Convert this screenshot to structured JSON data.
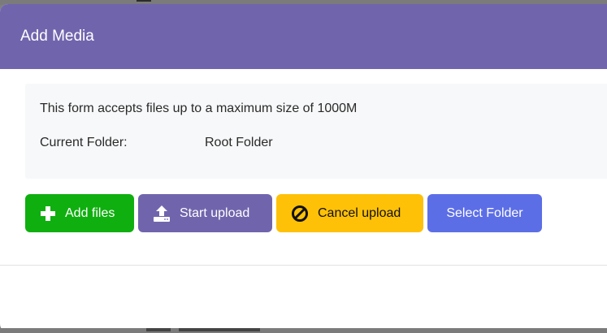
{
  "modal": {
    "title": "Add Media"
  },
  "info": {
    "limit_text": "This form accepts files up to a maximum size of 1000M",
    "current_folder_label": "Current Folder:",
    "current_folder_value": "Root Folder"
  },
  "buttons": {
    "add_files": {
      "label": "Add files",
      "icon": "plus-icon",
      "color": "#0faf0f"
    },
    "start_upload": {
      "label": "Start upload",
      "icon": "upload-icon",
      "color": "#7065ad"
    },
    "cancel_upload": {
      "label": "Cancel upload",
      "icon": "ban-icon",
      "color": "#ffc107"
    },
    "select_folder": {
      "label": "Select Folder",
      "color": "#5c6ee6"
    }
  },
  "colors": {
    "header": "#7065ad",
    "panel": "#f7f8f9"
  }
}
